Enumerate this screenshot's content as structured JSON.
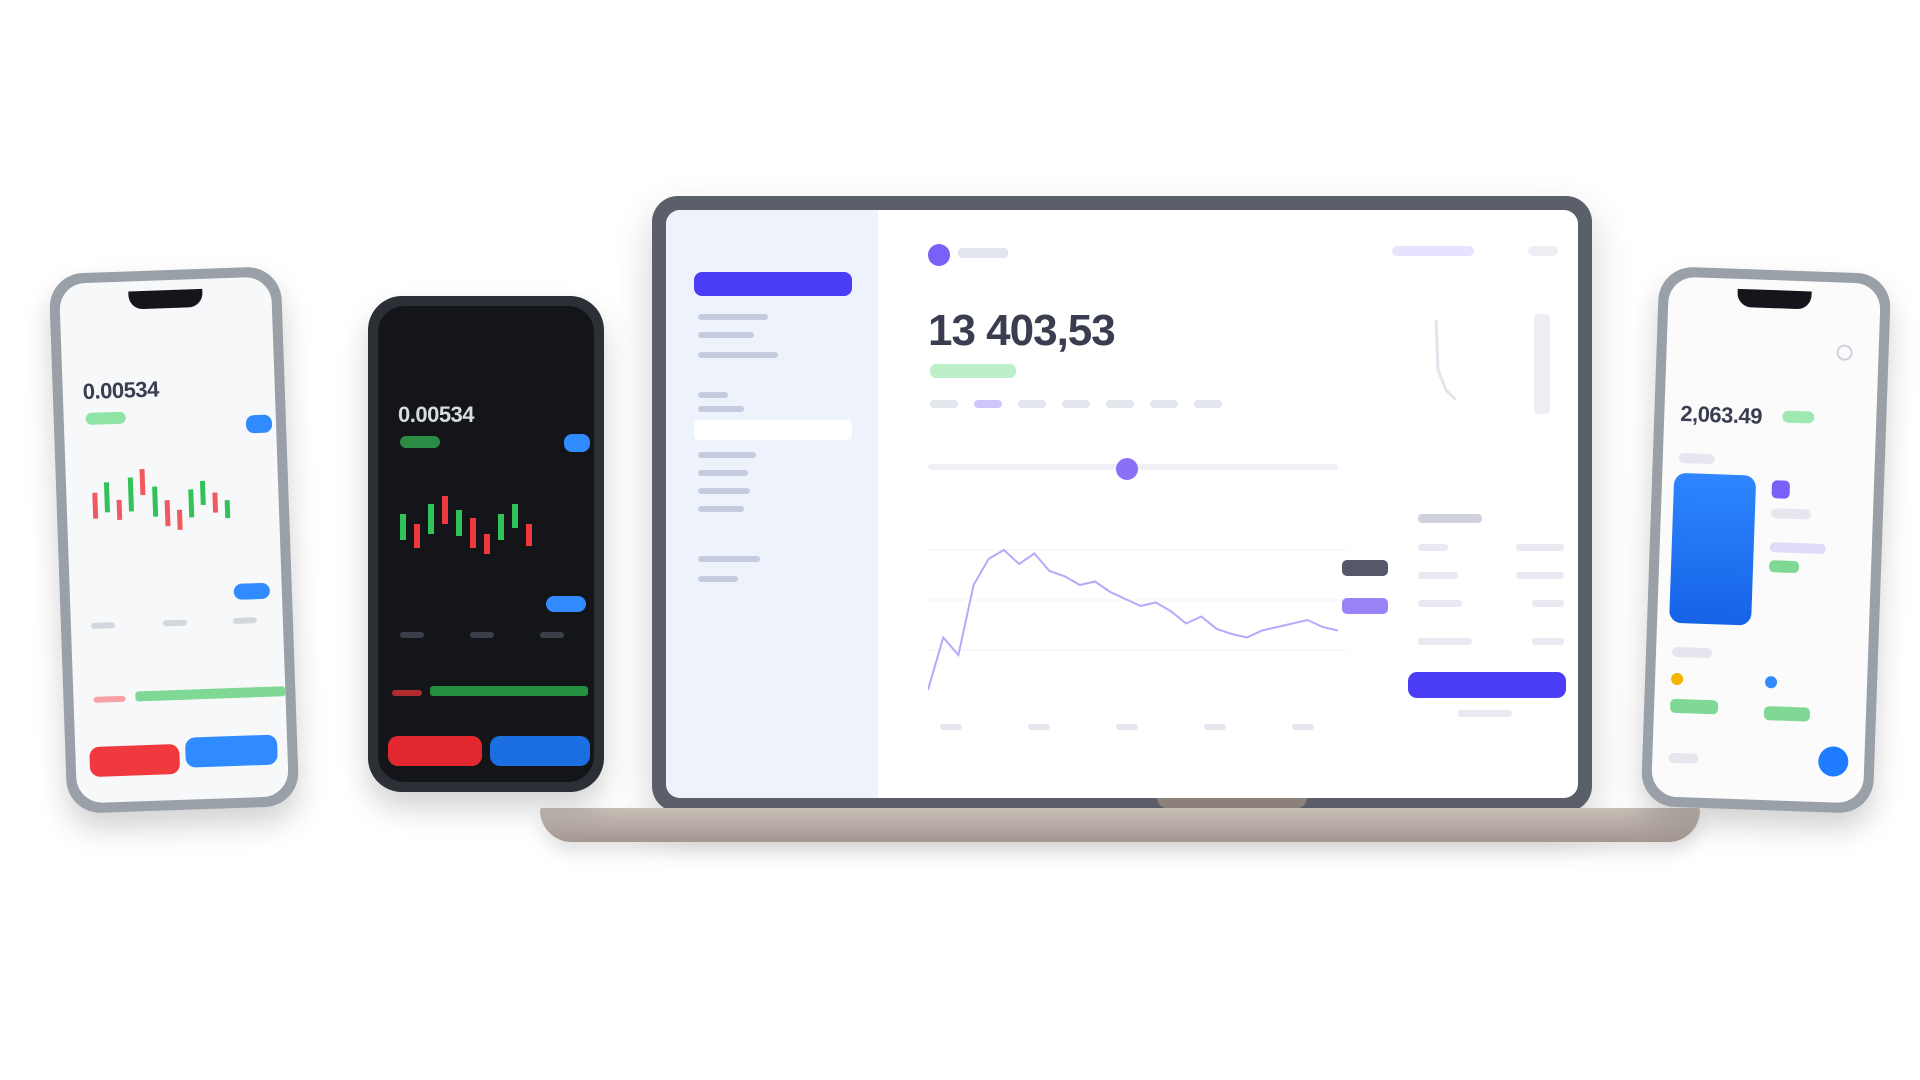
{
  "colors": {
    "accent": "#4b3cf5",
    "accent_light": "#8a70f7",
    "positive": "#2db84d",
    "negative": "#f0393e",
    "phone_blue": "#2f8bff"
  },
  "laptop": {
    "sidebar": {
      "cta_label": ""
    },
    "header": {
      "logo_icon": "logo-circle-icon"
    },
    "balance": "13 403,53",
    "chart_series": [
      10,
      40,
      30,
      70,
      85,
      90,
      82,
      88,
      78,
      75,
      70,
      72,
      66,
      62,
      58,
      60,
      55,
      48,
      52,
      45,
      42,
      40,
      44,
      46,
      48,
      50,
      46,
      44
    ]
  },
  "phones": {
    "phone1": {
      "title": "0.00534",
      "theme": "light",
      "stats": [
        "",
        "",
        ""
      ],
      "sell_label": "",
      "buy_label": ""
    },
    "phone2": {
      "title": "0.00534",
      "theme": "dark",
      "stats": [
        "",
        "",
        ""
      ],
      "sell_label": "",
      "buy_label": ""
    },
    "phone3": {
      "title": "2,063.49",
      "theme": "light"
    }
  }
}
